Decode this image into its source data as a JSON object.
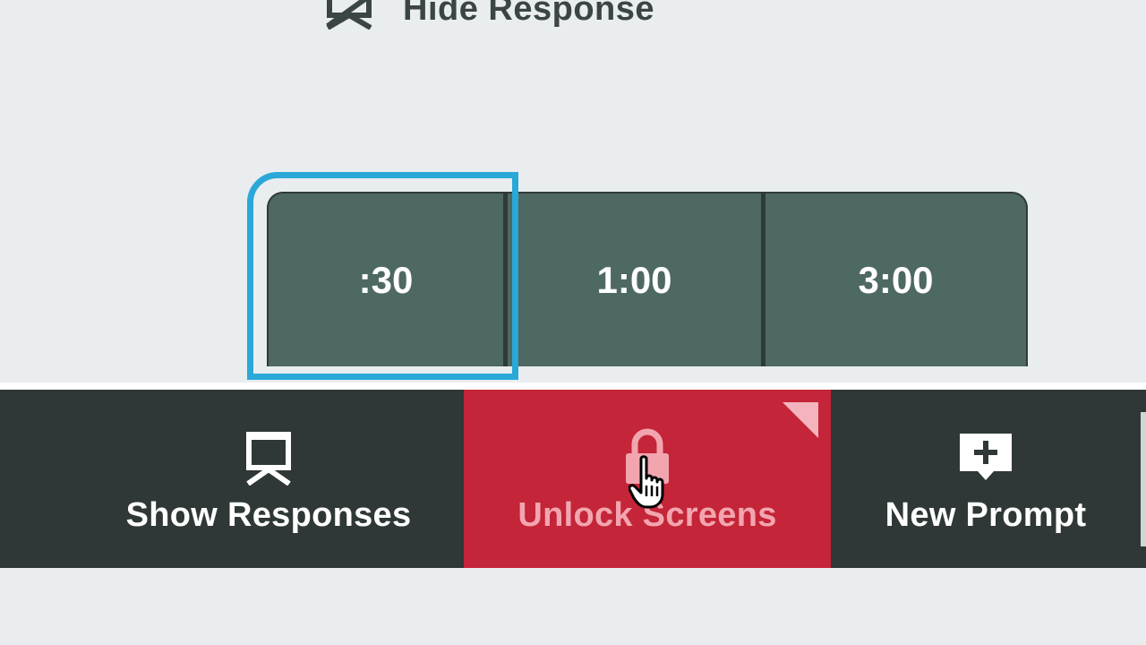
{
  "top_item": {
    "label": "Hide Response",
    "icon": "hide-projector-icon"
  },
  "timer": {
    "options": [
      ":30",
      "1:00",
      "3:00"
    ],
    "focused_index": 0,
    "focus_color": "#2aa8d8",
    "button_color": "#4e6863"
  },
  "toolbar": {
    "show_responses": {
      "label": "Show Responses",
      "icon": "projector-icon"
    },
    "unlock_screens": {
      "label": "Unlock Screens",
      "icon": "lock-icon",
      "color": "#c42538"
    },
    "new_prompt": {
      "label": "New Prompt",
      "icon": "add-comment-icon"
    }
  }
}
